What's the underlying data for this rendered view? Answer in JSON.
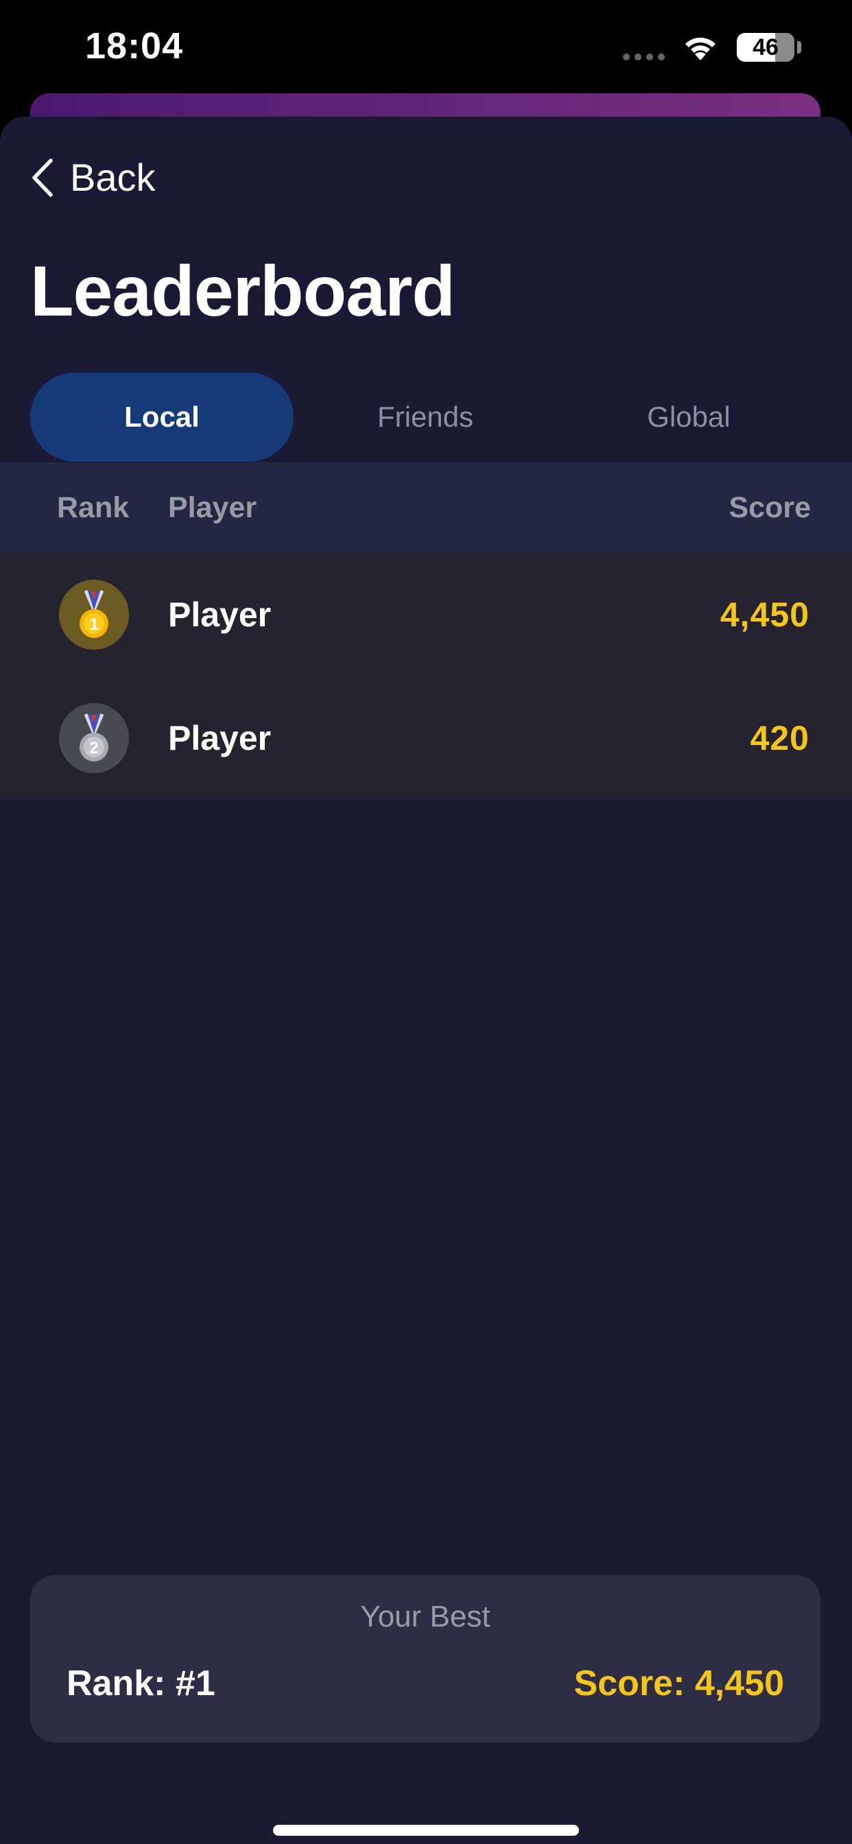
{
  "status_bar": {
    "time": "18:04",
    "battery": "46"
  },
  "header": {
    "back_label": "Back",
    "title": "Leaderboard"
  },
  "tabs": [
    {
      "label": "Local",
      "selected": true
    },
    {
      "label": "Friends",
      "selected": false
    },
    {
      "label": "Global",
      "selected": false
    }
  ],
  "table": {
    "columns": [
      "Rank",
      "Player",
      "Score"
    ],
    "rows": [
      {
        "rank": 1,
        "medal": "gold-medal-icon",
        "player": "Player",
        "score": "4,450"
      },
      {
        "rank": 2,
        "medal": "silver-medal-icon",
        "player": "Player",
        "score": "420"
      }
    ]
  },
  "your_best": {
    "title": "Your Best",
    "rank": "Rank: #1",
    "score": "Score: 4,450"
  },
  "colors": {
    "background": "#1b1a35",
    "accent_tab": "#163a78",
    "score": "#f5c518",
    "row": "#25232f"
  }
}
